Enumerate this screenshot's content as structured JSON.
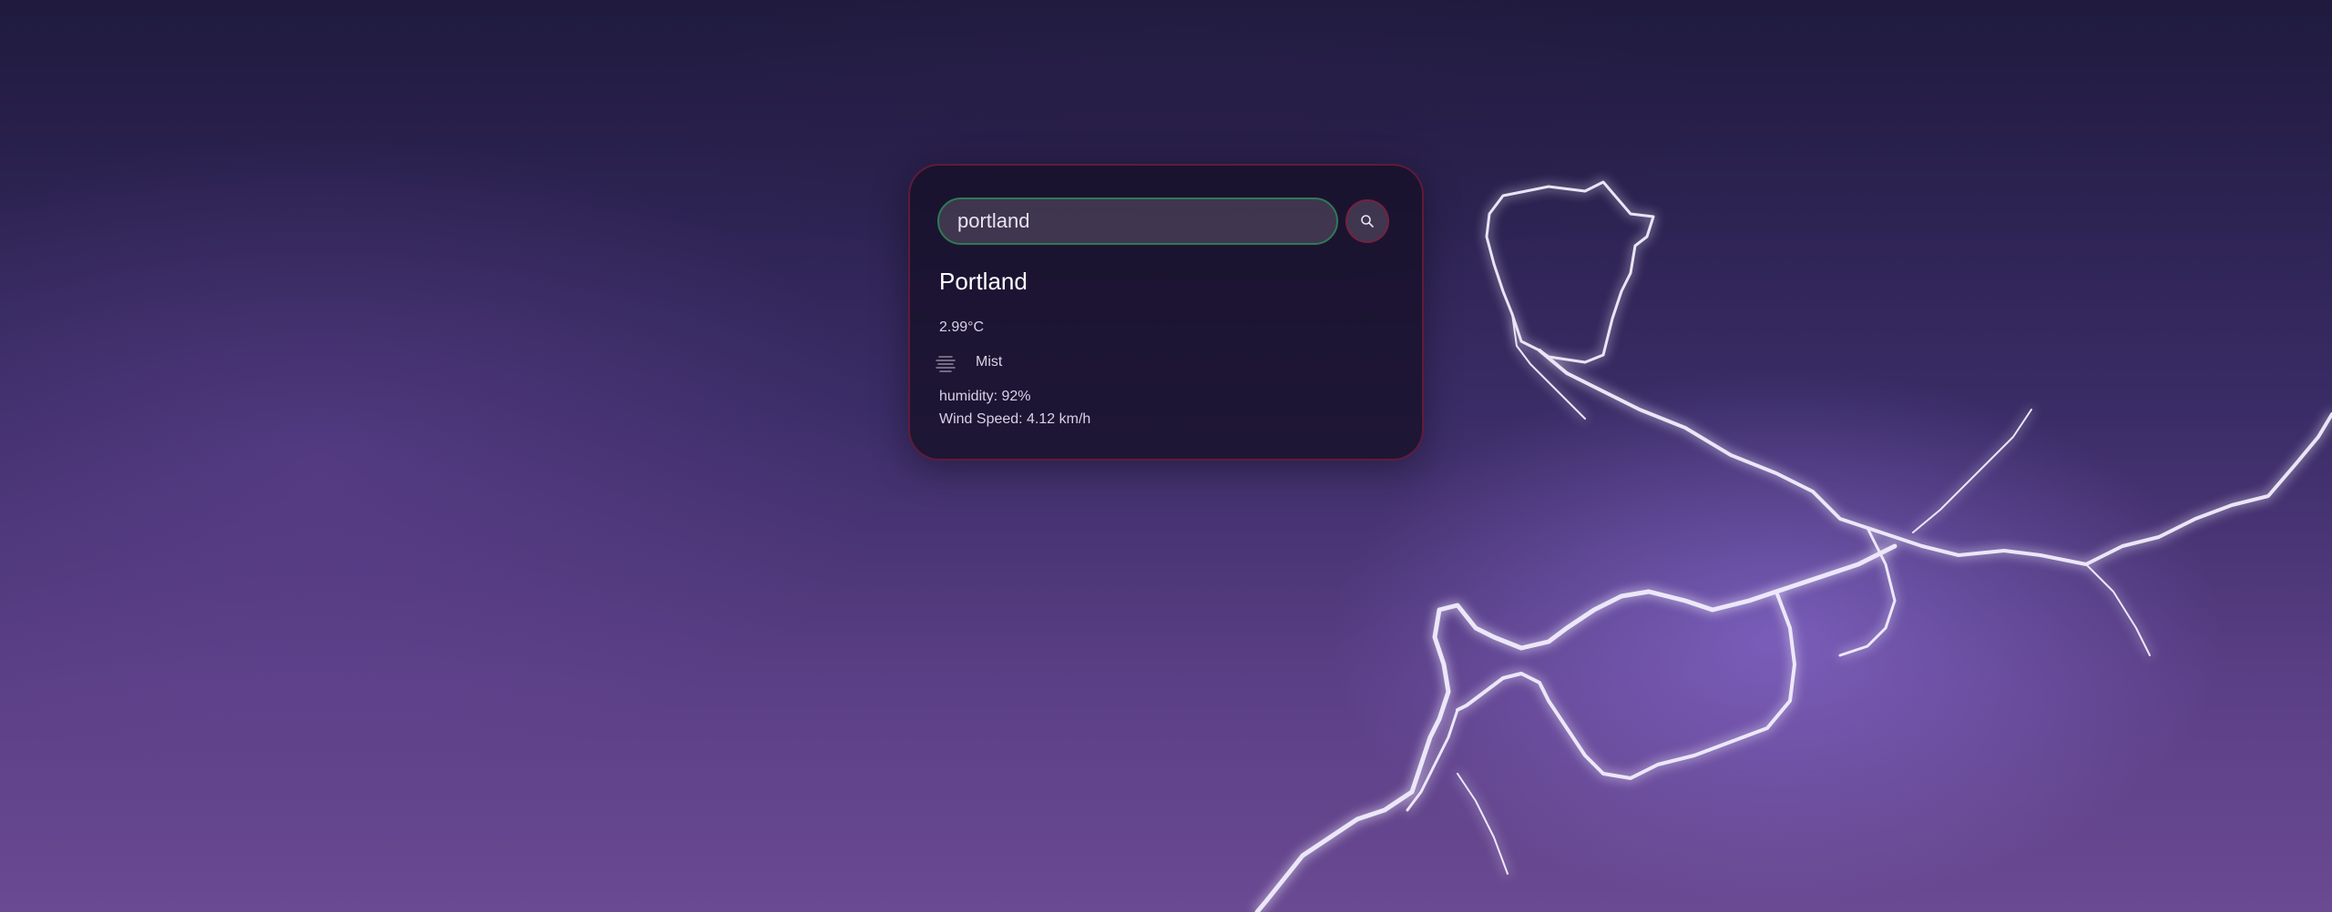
{
  "search": {
    "value": "portland",
    "button_icon": "search-icon"
  },
  "weather": {
    "city": "Portland",
    "temperature": "2.99°C",
    "condition": "Mist",
    "condition_icon": "mist-icon",
    "humidity": "humidity: 92%",
    "wind_speed": "Wind Speed: 4.12 km/h"
  },
  "colors": {
    "card_border": "#78203c",
    "input_border": "#2f7a55",
    "background_dark": "#1f1a3e",
    "background_light": "#6a4a92",
    "lightning": "#f4f0ff"
  }
}
